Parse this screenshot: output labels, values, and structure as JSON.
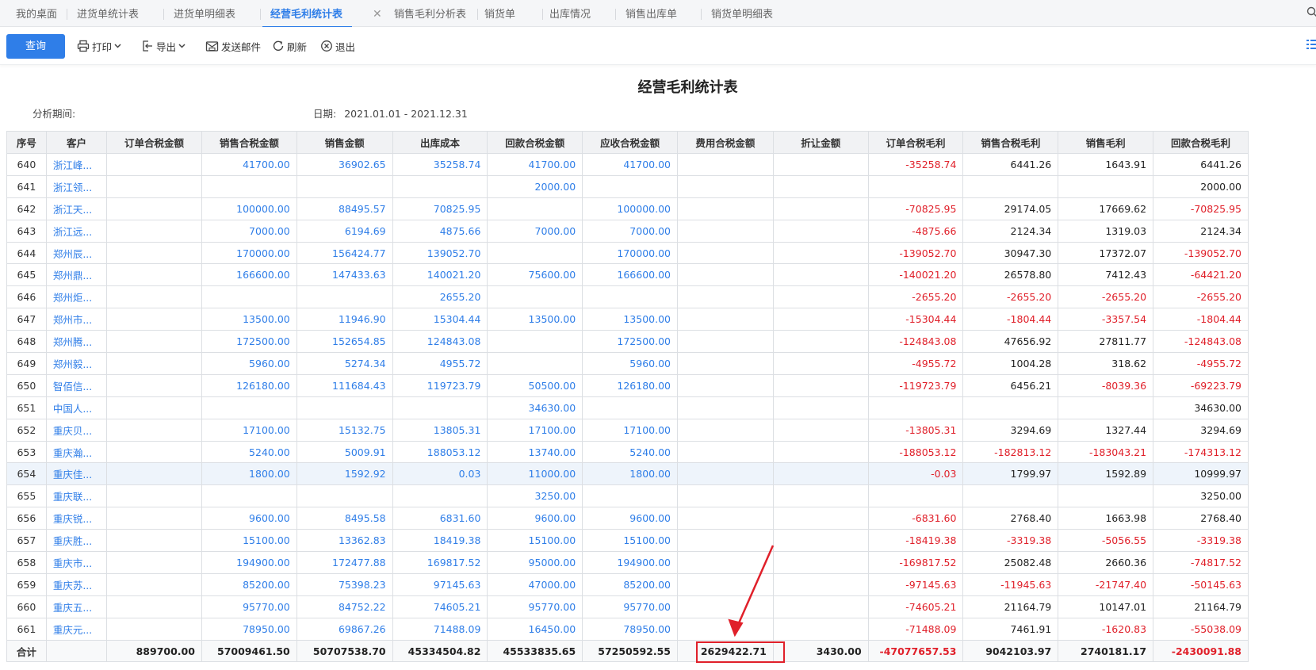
{
  "tabs": [
    {
      "label": "我的桌面"
    },
    {
      "label": "进货单统计表"
    },
    {
      "label": "进货单明细表"
    },
    {
      "label": "经营毛利统计表",
      "active": true
    },
    {
      "label": "销售毛利分析表"
    },
    {
      "label": "销货单"
    },
    {
      "label": "出库情况"
    },
    {
      "label": "销售出库单"
    },
    {
      "label": "销货单明细表"
    }
  ],
  "toolbar": {
    "query": "查询",
    "print": "打印",
    "export": "导出",
    "email": "发送邮件",
    "refresh": "刷新",
    "exit": "退出"
  },
  "report": {
    "title": "经营毛利统计表",
    "period_label": "分析期间:",
    "date_label": "日期:",
    "date_range": "2021.01.01 - 2021.12.31"
  },
  "table": {
    "columns": [
      "序号",
      "客户",
      "订单合税金额",
      "销售合税金额",
      "销售金额",
      "出库成本",
      "回款合税金额",
      "应收合税金额",
      "费用合税金额",
      "折让金额",
      "订单合税毛利",
      "销售合税毛利",
      "销售毛利",
      "回款合税毛利"
    ],
    "rows": [
      {
        "seq": "640",
        "cust": "浙江峰...",
        "c": [
          "",
          "41700.00",
          "36902.65",
          "35258.74",
          "41700.00",
          "41700.00",
          "",
          "",
          "-35258.74",
          "6441.26",
          "1643.91",
          "6441.26"
        ]
      },
      {
        "seq": "641",
        "cust": "浙江领...",
        "c": [
          "",
          "",
          "",
          "",
          "2000.00",
          "",
          "",
          "",
          "",
          "",
          "",
          "2000.00"
        ]
      },
      {
        "seq": "642",
        "cust": "浙江天...",
        "c": [
          "",
          "100000.00",
          "88495.57",
          "70825.95",
          "",
          "100000.00",
          "",
          "",
          "-70825.95",
          "29174.05",
          "17669.62",
          "-70825.95"
        ]
      },
      {
        "seq": "643",
        "cust": "浙江远...",
        "c": [
          "",
          "7000.00",
          "6194.69",
          "4875.66",
          "7000.00",
          "7000.00",
          "",
          "",
          "-4875.66",
          "2124.34",
          "1319.03",
          "2124.34"
        ]
      },
      {
        "seq": "644",
        "cust": "郑州辰...",
        "c": [
          "",
          "170000.00",
          "156424.77",
          "139052.70",
          "",
          "170000.00",
          "",
          "",
          "-139052.70",
          "30947.30",
          "17372.07",
          "-139052.70"
        ]
      },
      {
        "seq": "645",
        "cust": "郑州鼎...",
        "c": [
          "",
          "166600.00",
          "147433.63",
          "140021.20",
          "75600.00",
          "166600.00",
          "",
          "",
          "-140021.20",
          "26578.80",
          "7412.43",
          "-64421.20"
        ]
      },
      {
        "seq": "646",
        "cust": "郑州炬...",
        "c": [
          "",
          "",
          "",
          "2655.20",
          "",
          "",
          "",
          "",
          "-2655.20",
          "-2655.20",
          "-2655.20",
          "-2655.20"
        ]
      },
      {
        "seq": "647",
        "cust": "郑州市...",
        "c": [
          "",
          "13500.00",
          "11946.90",
          "15304.44",
          "13500.00",
          "13500.00",
          "",
          "",
          "-15304.44",
          "-1804.44",
          "-3357.54",
          "-1804.44"
        ]
      },
      {
        "seq": "648",
        "cust": "郑州腾...",
        "c": [
          "",
          "172500.00",
          "152654.85",
          "124843.08",
          "",
          "172500.00",
          "",
          "",
          "-124843.08",
          "47656.92",
          "27811.77",
          "-124843.08"
        ]
      },
      {
        "seq": "649",
        "cust": "郑州毅...",
        "c": [
          "",
          "5960.00",
          "5274.34",
          "4955.72",
          "",
          "5960.00",
          "",
          "",
          "-4955.72",
          "1004.28",
          "318.62",
          "-4955.72"
        ]
      },
      {
        "seq": "650",
        "cust": "智佰信...",
        "c": [
          "",
          "126180.00",
          "111684.43",
          "119723.79",
          "50500.00",
          "126180.00",
          "",
          "",
          "-119723.79",
          "6456.21",
          "-8039.36",
          "-69223.79"
        ]
      },
      {
        "seq": "651",
        "cust": "中国人...",
        "c": [
          "",
          "",
          "",
          "",
          "34630.00",
          "",
          "",
          "",
          "",
          "",
          "",
          "34630.00"
        ]
      },
      {
        "seq": "652",
        "cust": "重庆贝...",
        "c": [
          "",
          "17100.00",
          "15132.75",
          "13805.31",
          "17100.00",
          "17100.00",
          "",
          "",
          "-13805.31",
          "3294.69",
          "1327.44",
          "3294.69"
        ]
      },
      {
        "seq": "653",
        "cust": "重庆瀚...",
        "c": [
          "",
          "5240.00",
          "5009.91",
          "188053.12",
          "13740.00",
          "5240.00",
          "",
          "",
          "-188053.12",
          "-182813.12",
          "-183043.21",
          "-174313.12"
        ]
      },
      {
        "seq": "654",
        "cust": "重庆佳...",
        "c": [
          "",
          "1800.00",
          "1592.92",
          "0.03",
          "11000.00",
          "1800.00",
          "",
          "",
          "-0.03",
          "1799.97",
          "1592.89",
          "10999.97"
        ],
        "hl": true
      },
      {
        "seq": "655",
        "cust": "重庆联...",
        "c": [
          "",
          "",
          "",
          "",
          "3250.00",
          "",
          "",
          "",
          "",
          "",
          "",
          "3250.00"
        ]
      },
      {
        "seq": "656",
        "cust": "重庆锐...",
        "c": [
          "",
          "9600.00",
          "8495.58",
          "6831.60",
          "9600.00",
          "9600.00",
          "",
          "",
          "-6831.60",
          "2768.40",
          "1663.98",
          "2768.40"
        ]
      },
      {
        "seq": "657",
        "cust": "重庆胜...",
        "c": [
          "",
          "15100.00",
          "13362.83",
          "18419.38",
          "15100.00",
          "15100.00",
          "",
          "",
          "-18419.38",
          "-3319.38",
          "-5056.55",
          "-3319.38"
        ]
      },
      {
        "seq": "658",
        "cust": "重庆市...",
        "c": [
          "",
          "194900.00",
          "172477.88",
          "169817.52",
          "95000.00",
          "194900.00",
          "",
          "",
          "-169817.52",
          "25082.48",
          "2660.36",
          "-74817.52"
        ]
      },
      {
        "seq": "659",
        "cust": "重庆苏...",
        "c": [
          "",
          "85200.00",
          "75398.23",
          "97145.63",
          "47000.00",
          "85200.00",
          "",
          "",
          "-97145.63",
          "-11945.63",
          "-21747.40",
          "-50145.63"
        ]
      },
      {
        "seq": "660",
        "cust": "重庆五...",
        "c": [
          "",
          "95770.00",
          "84752.22",
          "74605.21",
          "95770.00",
          "95770.00",
          "",
          "",
          "-74605.21",
          "21164.79",
          "10147.01",
          "21164.79"
        ]
      },
      {
        "seq": "661",
        "cust": "重庆元...",
        "c": [
          "",
          "78950.00",
          "69867.26",
          "71488.09",
          "16450.00",
          "78950.00",
          "",
          "",
          "-71488.09",
          "7461.91",
          "-1620.83",
          "-55038.09"
        ]
      }
    ],
    "total": {
      "label": "合计",
      "c": [
        "889700.00",
        "57009461.50",
        "50707538.70",
        "45334504.82",
        "45533835.65",
        "57250592.55",
        "2629422.71",
        "3430.00",
        "-47077657.53",
        "9042103.97",
        "2740181.17",
        "-2430091.88"
      ]
    }
  },
  "colors": {
    "accent": "#2f7ee8",
    "negative": "#e0202a",
    "highlight_box": "#e0202a"
  }
}
